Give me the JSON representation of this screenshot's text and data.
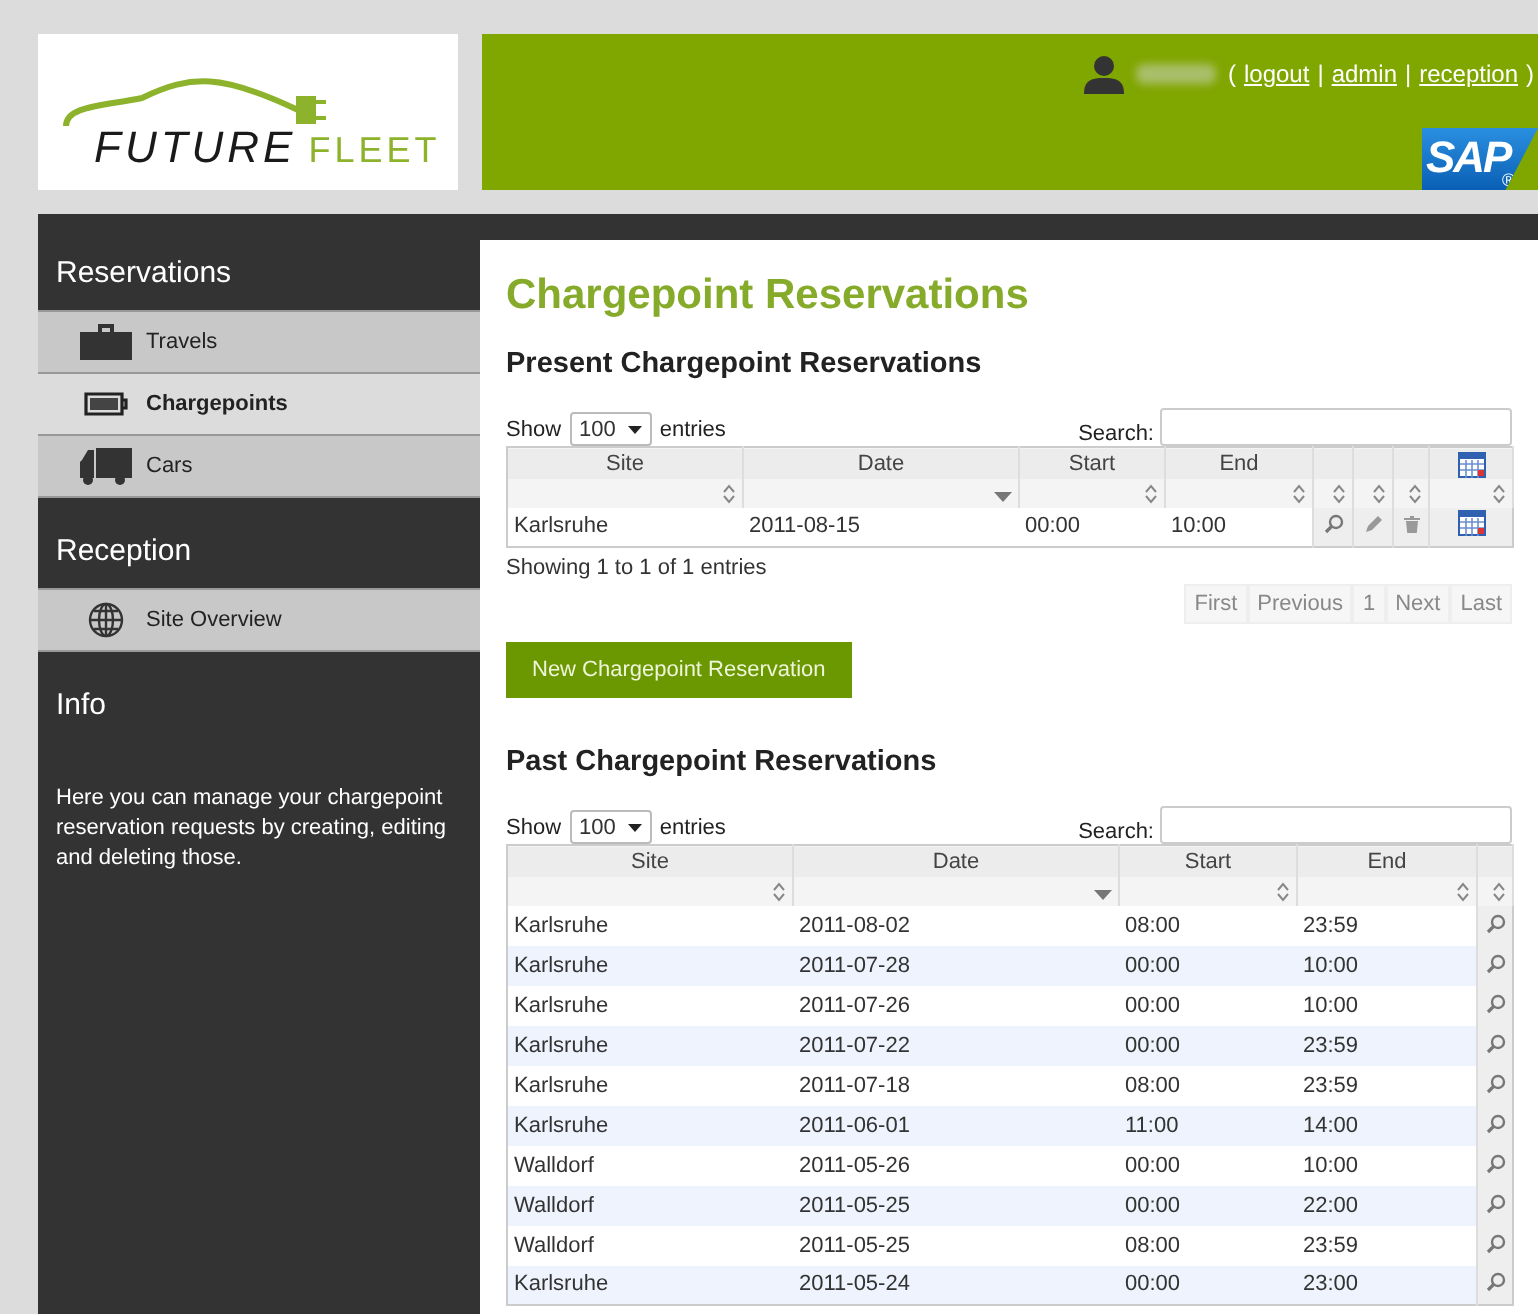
{
  "logo": {
    "word_1": "FUTURE",
    "word_2": "FLEET"
  },
  "user_bar": {
    "open": "(",
    "links": [
      {
        "label": "logout"
      },
      {
        "label": "admin"
      },
      {
        "label": "reception"
      }
    ],
    "separator": "|",
    "close": ")"
  },
  "sap_logo": {
    "text": "SAP",
    "mark": "®"
  },
  "sidebar": {
    "sections": [
      {
        "title": "Reservations",
        "items": [
          {
            "label": "Travels",
            "kind": "briefcase",
            "selected": false
          },
          {
            "label": "Chargepoints",
            "kind": "battery",
            "selected": true
          },
          {
            "label": "Cars",
            "kind": "truck",
            "selected": false
          }
        ]
      },
      {
        "title": "Reception",
        "items": [
          {
            "label": "Site Overview",
            "kind": "globe",
            "selected": false
          }
        ]
      },
      {
        "title": "Info",
        "text": "Here you can manage your chargepoint reservation requests by creating, editing and deleting those."
      }
    ]
  },
  "page_title": "Chargepoint Reservations",
  "present": {
    "heading": "Present Chargepoint Reservations",
    "show_label": "Show",
    "page_size": "100",
    "entries_label": "entries",
    "search_label": "Search:",
    "columns": [
      {
        "kind": "text",
        "label": "Site",
        "sorted": false
      },
      {
        "kind": "text",
        "label": "Date",
        "sorted": true
      },
      {
        "kind": "text",
        "label": "Start",
        "sorted": false
      },
      {
        "kind": "text",
        "label": "End",
        "sorted": false
      },
      {
        "kind": "view",
        "sorted": false
      },
      {
        "kind": "edit",
        "sorted": false
      },
      {
        "kind": "delete",
        "sorted": false
      },
      {
        "kind": "calendar",
        "sorted": false
      }
    ],
    "rows": [
      [
        "Karlsruhe",
        "2011-08-15",
        "00:00",
        "10:00"
      ]
    ],
    "info": "Showing 1 to 1 of 1 entries",
    "pagination": [
      {
        "label": "First",
        "disabled": true
      },
      {
        "label": "Previous",
        "disabled": true
      },
      {
        "label": "1",
        "disabled": true
      },
      {
        "label": "Next",
        "disabled": true
      },
      {
        "label": "Last",
        "disabled": true
      }
    ],
    "new_button": "New Chargepoint Reservation"
  },
  "past": {
    "heading": "Past Chargepoint Reservations",
    "show_label": "Show",
    "page_size": "100",
    "entries_label": "entries",
    "search_label": "Search:",
    "columns": [
      {
        "kind": "text",
        "label": "Site",
        "sorted": false
      },
      {
        "kind": "text",
        "label": "Date",
        "sorted": true
      },
      {
        "kind": "text",
        "label": "Start",
        "sorted": false
      },
      {
        "kind": "text",
        "label": "End",
        "sorted": false
      },
      {
        "kind": "view",
        "sorted": false
      }
    ],
    "rows": [
      [
        "Karlsruhe",
        "2011-08-02",
        "08:00",
        "23:59"
      ],
      [
        "Karlsruhe",
        "2011-07-28",
        "00:00",
        "10:00"
      ],
      [
        "Karlsruhe",
        "2011-07-26",
        "00:00",
        "10:00"
      ],
      [
        "Karlsruhe",
        "2011-07-22",
        "00:00",
        "23:59"
      ],
      [
        "Karlsruhe",
        "2011-07-18",
        "08:00",
        "23:59"
      ],
      [
        "Karlsruhe",
        "2011-06-01",
        "11:00",
        "14:00"
      ],
      [
        "Walldorf",
        "2011-05-26",
        "00:00",
        "10:00"
      ],
      [
        "Walldorf",
        "2011-05-25",
        "00:00",
        "22:00"
      ],
      [
        "Walldorf",
        "2011-05-25",
        "08:00",
        "23:59"
      ],
      [
        "Karlsruhe",
        "2011-05-24",
        "00:00",
        "23:00"
      ]
    ]
  }
}
